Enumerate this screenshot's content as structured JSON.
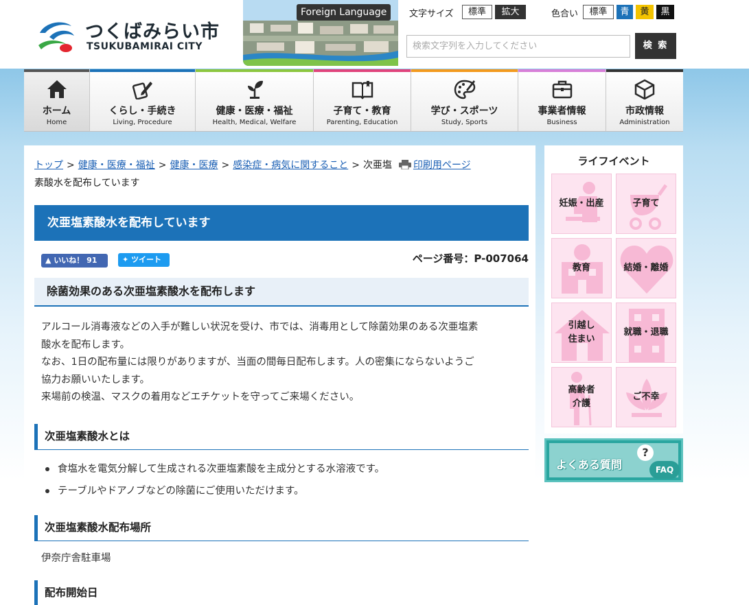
{
  "header": {
    "logo_jp": "つくばみらい市",
    "logo_en": "TSUKUBAMIRAI CITY",
    "foreign_language": "Foreign Language",
    "font_size_label": "文字サイズ",
    "font_size_standard": "標準",
    "font_size_large": "拡大",
    "color_label": "色合い",
    "color_standard": "標準",
    "color_blue": "青",
    "color_yellow": "黄",
    "color_black": "黒",
    "search_placeholder": "検索文字列を入力してください",
    "search_button": "検 索"
  },
  "nav": [
    {
      "jp": "ホーム",
      "en": "Home",
      "color": "#555555",
      "icon": "house-icon"
    },
    {
      "jp": "くらし・手続き",
      "en": "Living, Procedure",
      "color": "#1c72b8",
      "icon": "pen-paper-icon"
    },
    {
      "jp": "健康・医療・福祉",
      "en": "Health, Medical, Welfare",
      "color": "#8cc63f",
      "icon": "sprout-icon"
    },
    {
      "jp": "子育て・教育",
      "en": "Parenting, Education",
      "color": "#e0447c",
      "icon": "book-icon"
    },
    {
      "jp": "学び・スポーツ",
      "en": "Study, Sports",
      "color": "#f39a1e",
      "icon": "palette-icon"
    },
    {
      "jp": "事業者情報",
      "en": "Business",
      "color": "#d77fd8",
      "icon": "briefcase-icon"
    },
    {
      "jp": "市政情報",
      "en": "Administration",
      "color": "#333333",
      "icon": "cube-icon"
    }
  ],
  "breadcrumb": {
    "items": [
      "トップ",
      "健康・医療・福祉",
      "健康・医療",
      "感染症・病気に関すること"
    ],
    "current": "次亜塩素酸水を配布しています",
    "current_line1": "次亜塩",
    "current_line2": "素酸水を配布しています",
    "separator": ">",
    "print_link": "印刷用ページ"
  },
  "page": {
    "title": "次亜塩素酸水を配布しています",
    "like_label": "いいね！ 91",
    "tweet_label": "ツイート",
    "page_number": "ページ番号：P-007064",
    "h2": "除菌効果のある次亜塩素酸水を配布します",
    "paragraph_line1": "アルコール消毒液などの入手が難しい状況を受け、市では、消毒用として除菌効果のある次亜塩素",
    "paragraph_line2": "酸水を配布します。",
    "paragraph_line3": "なお、1日の配布量には限りがありますが、当面の間毎日配布します。人の密集にならないようご",
    "paragraph_line4": "協力お願いいたします。",
    "paragraph_line5": "来場前の検温、マスクの着用などエチケットを守ってご来場ください。",
    "h3_what": "次亜塩素酸水とは",
    "bullets": [
      "食塩水を電気分解して生成される次亜塩素酸を主成分とする水溶液です。",
      "テーブルやドアノブなどの除菌にご使用いただけます。"
    ],
    "h3_place": "次亜塩素酸水配布場所",
    "place": "伊奈庁舎駐車場",
    "h3_start": "配布開始日"
  },
  "sidebar": {
    "title": "ライフイベント",
    "tiles": [
      {
        "label": "妊娠・出産",
        "icon": "pregnancy-icon"
      },
      {
        "label": "子育て",
        "icon": "stroller-icon"
      },
      {
        "label": "教育",
        "icon": "school-icon"
      },
      {
        "label": "結婚・離婚",
        "icon": "heart-icon"
      },
      {
        "label": "引越し\n住まい",
        "icon": "house-icon"
      },
      {
        "label": "就職・退職",
        "icon": "building-icon"
      },
      {
        "label": "高齢者\n介護",
        "icon": "elderly-icon"
      },
      {
        "label": "ご不幸",
        "icon": "lotus-icon"
      }
    ],
    "faq_text": "よくある質問",
    "faq_q": "?",
    "faq_badge": "FAQ"
  }
}
